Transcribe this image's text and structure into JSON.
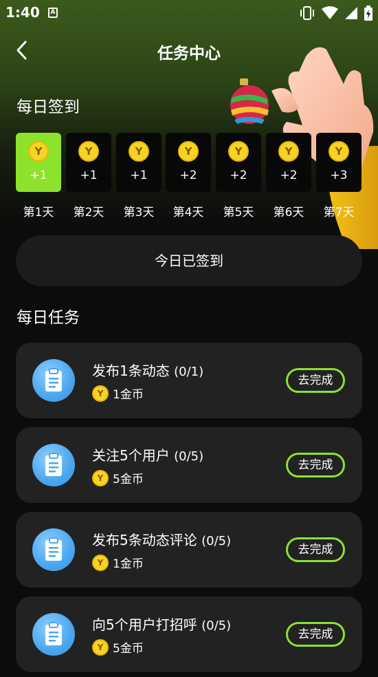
{
  "status_bar": {
    "time": "1:40",
    "notification_icon_letter": "A"
  },
  "header": {
    "title": "任务中心"
  },
  "checkin": {
    "section_title": "每日签到",
    "coin_letter": "Y",
    "days": [
      {
        "label": "第1天",
        "reward": "+1",
        "signed": true
      },
      {
        "label": "第2天",
        "reward": "+1",
        "signed": false
      },
      {
        "label": "第3天",
        "reward": "+1",
        "signed": false
      },
      {
        "label": "第4天",
        "reward": "+2",
        "signed": false
      },
      {
        "label": "第5天",
        "reward": "+2",
        "signed": false
      },
      {
        "label": "第6天",
        "reward": "+2",
        "signed": false
      },
      {
        "label": "第7天",
        "reward": "+3",
        "signed": false
      }
    ],
    "button_label": "今日已签到"
  },
  "tasks": {
    "section_title": "每日任务",
    "items": [
      {
        "name": "发布1条动态",
        "progress": "(0/1)",
        "reward": "1金币",
        "action": "去完成"
      },
      {
        "name": "关注5个用户",
        "progress": "(0/5)",
        "reward": "5金币",
        "action": "去完成"
      },
      {
        "name": "发布5条动态评论",
        "progress": "(0/5)",
        "reward": "1金币",
        "action": "去完成"
      },
      {
        "name": "向5个用户打招呼",
        "progress": "(0/5)",
        "reward": "5金币",
        "action": "去完成"
      }
    ]
  },
  "colors": {
    "accent_green": "#8de22c",
    "coin_yellow": "#f6d426",
    "card_bg": "#222222"
  }
}
